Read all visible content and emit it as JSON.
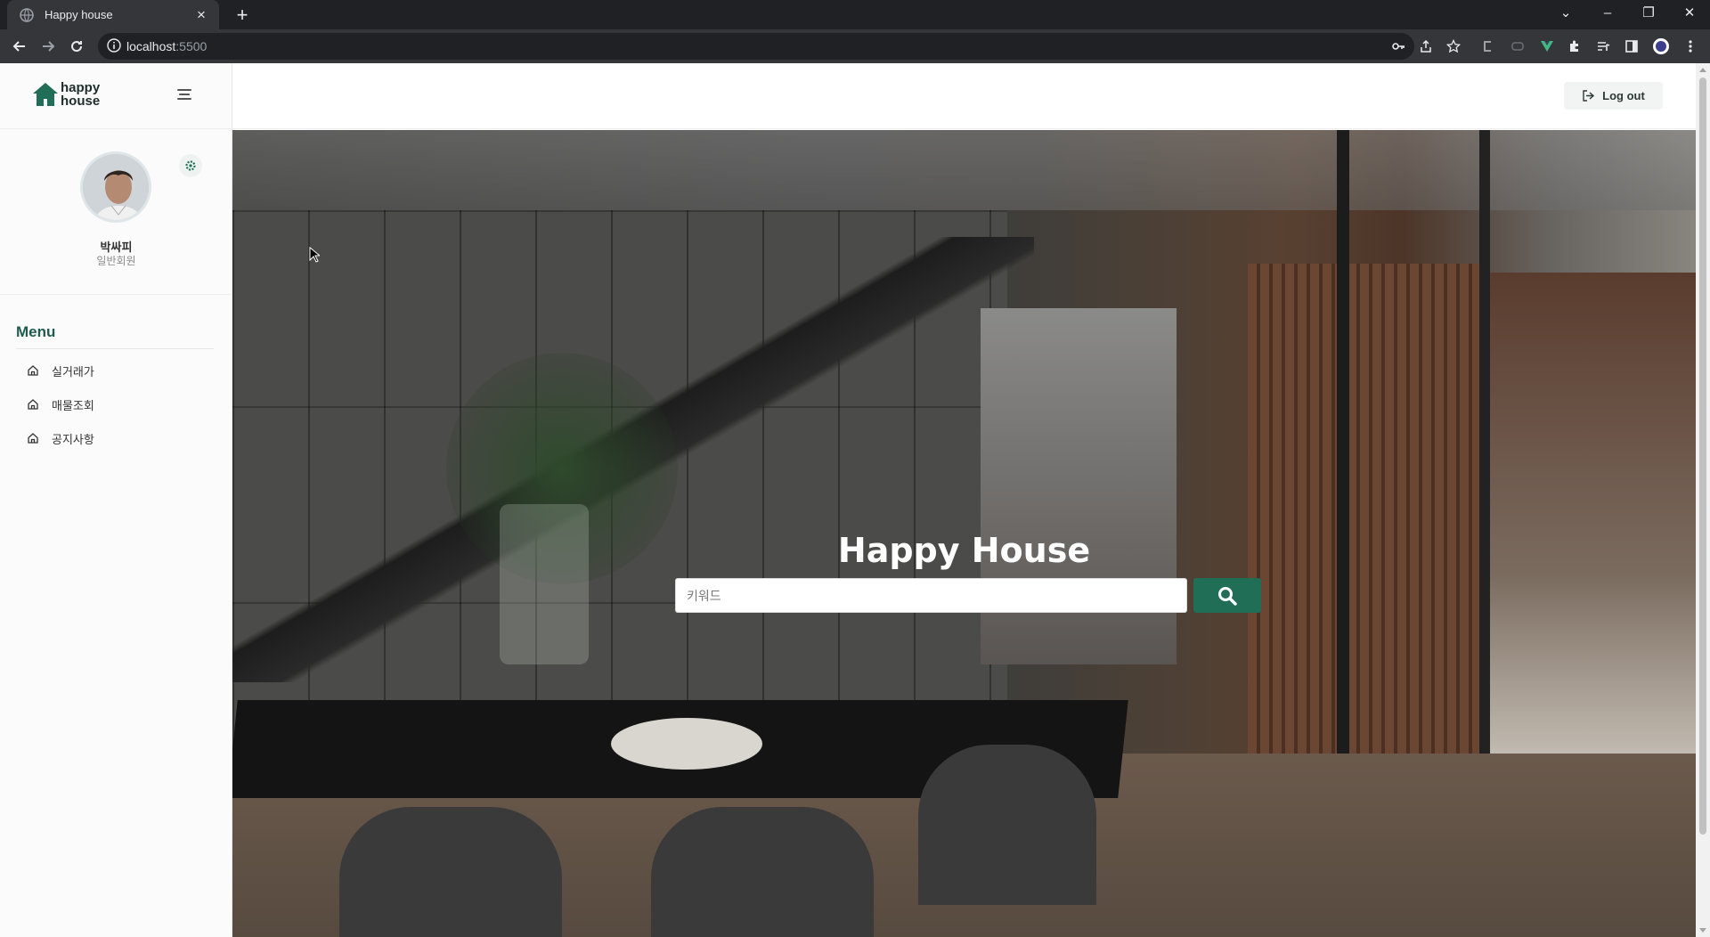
{
  "browser": {
    "tab_title": "Happy house",
    "tab_close": "×",
    "new_tab": "+",
    "url_host": "localhost",
    "url_port": ":5500",
    "win_minimize": "–",
    "win_restore": "❐",
    "win_close": "✕",
    "tab_search": "⌄"
  },
  "sidebar": {
    "logo_line1": "happy",
    "logo_line2": "house",
    "user_name": "박싸피",
    "user_role": "일반회원",
    "menu_title": "Menu",
    "items": [
      {
        "label": "실거래가",
        "icon": "home-icon"
      },
      {
        "label": "매물조회",
        "icon": "home-icon"
      },
      {
        "label": "공지사항",
        "icon": "home-icon"
      }
    ]
  },
  "topbar": {
    "logout_label": "Log out"
  },
  "hero": {
    "title": "Happy House",
    "search_placeholder": "키워드"
  },
  "colors": {
    "brand_green": "#1f6e55",
    "menu_title": "#1f5c4b"
  }
}
